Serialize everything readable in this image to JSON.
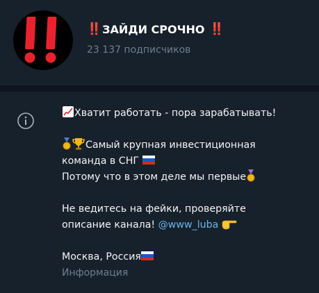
{
  "channel": {
    "title": "ЗАЙДИ СРОЧНО",
    "title_prefix": "‼️",
    "title_suffix": "‼️",
    "subscribers": "23 137 подписчиков"
  },
  "info": {
    "line1": "Хватит работать - пора зарабатывать!",
    "line2a": "Самый крупная инвестиционная",
    "line2b": "команда в СНГ",
    "line3": "Потому что в этом деле мы первые",
    "line4a": "Не ведитесь на фейки, проверяйте",
    "line4b": "описание канала! ",
    "handle": "@www_luba",
    "location": "Москва, Россия",
    "label": "Информация"
  },
  "icons": {
    "avatar": "double-exclamation-icon",
    "info": "info-circle-icon",
    "chart": "chart-increasing-icon",
    "medal": "medal-icon",
    "trophy": "trophy-icon",
    "flag": "russia-flag-icon",
    "pointing": "backhand-pointing-right-icon"
  },
  "colors": {
    "background": "#17212b",
    "separator": "#0e1621",
    "accent_red": "#e8232f",
    "link": "#64b5ef",
    "muted": "#6d7f8f"
  }
}
